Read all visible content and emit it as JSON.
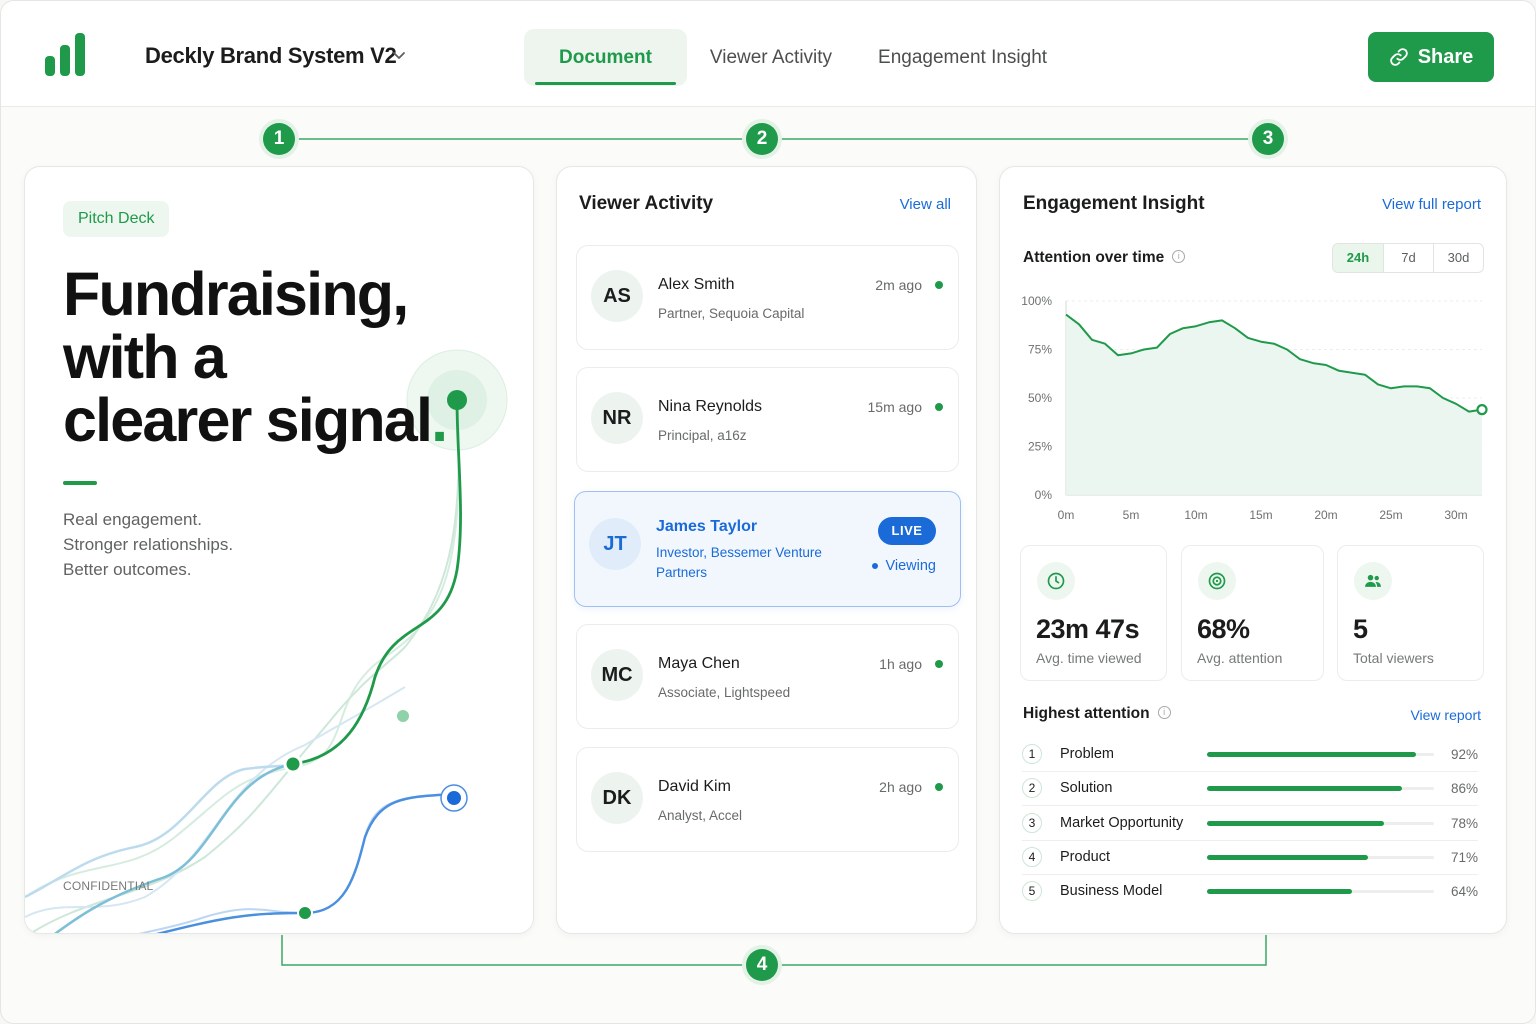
{
  "header": {
    "doc_title": "Deckly Brand System V2",
    "tabs": [
      {
        "label": "Document",
        "active": true
      },
      {
        "label": "Viewer Activity",
        "active": false
      },
      {
        "label": "Engagement Insight",
        "active": false
      }
    ],
    "share_label": "Share"
  },
  "steps": [
    "1",
    "2",
    "3",
    "4"
  ],
  "colors": {
    "brand": "#1f9a4a",
    "live": "#1a6bd8"
  },
  "deck": {
    "pill": "Pitch Deck",
    "headline": [
      "Fundraising,",
      "with a",
      "clearer signal"
    ],
    "headline_dot": ".",
    "tagline": [
      "Real engagement.",
      "Stronger relationships.",
      "Better outcomes."
    ],
    "footer": "CONFIDENTIAL"
  },
  "viewer_activity": {
    "title": "Viewer Activity",
    "view_all": "View all",
    "viewers": [
      {
        "initials": "AS",
        "name": "Alex Smith",
        "role": "Partner, Sequoia Capital",
        "time": "2m ago"
      },
      {
        "initials": "NR",
        "name": "Nina Reynolds",
        "role": "Principal, a16z",
        "time": "15m ago"
      },
      {
        "initials": "JT",
        "name": "James Taylor",
        "role": "Investor, Bessemer Venture Partners",
        "badge": "LIVE",
        "status": "Viewing"
      },
      {
        "initials": "MC",
        "name": "Maya Chen",
        "role": "Associate, Lightspeed",
        "time": "1h ago"
      },
      {
        "initials": "DK",
        "name": "David Kim",
        "role": "Analyst, Accel",
        "time": "2h ago"
      }
    ]
  },
  "engagement": {
    "title": "Engagement Insight",
    "full_report": "View full report",
    "attention_title": "Attention over time",
    "ranges": [
      "24h",
      "7d",
      "30d"
    ],
    "selected_range": "24h",
    "metrics": [
      {
        "icon": "clock-icon",
        "value": "23m 47s",
        "label": "Avg. time viewed"
      },
      {
        "icon": "target-icon",
        "value": "68%",
        "label": "Avg. attention"
      },
      {
        "icon": "users-icon",
        "value": "5",
        "label": "Total viewers"
      }
    ],
    "highest_title": "Highest attention",
    "view_report": "View report",
    "highest": [
      {
        "rank": "1",
        "name": "Problem",
        "pct_label": "92%",
        "value": 92
      },
      {
        "rank": "2",
        "name": "Solution",
        "pct_label": "86%",
        "value": 86
      },
      {
        "rank": "3",
        "name": "Market Opportunity",
        "pct_label": "78%",
        "value": 78
      },
      {
        "rank": "4",
        "name": "Product",
        "pct_label": "71%",
        "value": 71
      },
      {
        "rank": "5",
        "name": "Business Model",
        "pct_label": "64%",
        "value": 64
      }
    ]
  },
  "chart_data": {
    "type": "area",
    "title": "",
    "xlabel": "",
    "ylabel": "",
    "x_ticks": [
      "0m",
      "5m",
      "10m",
      "15m",
      "20m",
      "25m",
      "30m"
    ],
    "y_ticks": [
      "0%",
      "25%",
      "50%",
      "75%",
      "100%"
    ],
    "xlim": [
      0,
      32
    ],
    "ylim": [
      0,
      100
    ],
    "grid": true,
    "series": [
      {
        "values": [
          {
            "x": 0,
            "y": 93
          },
          {
            "x": 1,
            "y": 88
          },
          {
            "x": 2,
            "y": 80
          },
          {
            "x": 3,
            "y": 78
          },
          {
            "x": 4,
            "y": 72
          },
          {
            "x": 5,
            "y": 73
          },
          {
            "x": 6,
            "y": 75
          },
          {
            "x": 7,
            "y": 76
          },
          {
            "x": 8,
            "y": 83
          },
          {
            "x": 9,
            "y": 86
          },
          {
            "x": 10,
            "y": 87
          },
          {
            "x": 11,
            "y": 89
          },
          {
            "x": 12,
            "y": 90
          },
          {
            "x": 13,
            "y": 86
          },
          {
            "x": 14,
            "y": 81
          },
          {
            "x": 15,
            "y": 79
          },
          {
            "x": 16,
            "y": 78
          },
          {
            "x": 17,
            "y": 75
          },
          {
            "x": 18,
            "y": 70
          },
          {
            "x": 19,
            "y": 68
          },
          {
            "x": 20,
            "y": 67
          },
          {
            "x": 21,
            "y": 64
          },
          {
            "x": 22,
            "y": 63
          },
          {
            "x": 23,
            "y": 62
          },
          {
            "x": 24,
            "y": 57
          },
          {
            "x": 25,
            "y": 55
          },
          {
            "x": 26,
            "y": 56
          },
          {
            "x": 27,
            "y": 56
          },
          {
            "x": 28,
            "y": 55
          },
          {
            "x": 29,
            "y": 50
          },
          {
            "x": 30,
            "y": 47
          },
          {
            "x": 31,
            "y": 43
          },
          {
            "x": 32,
            "y": 44
          }
        ]
      }
    ]
  }
}
